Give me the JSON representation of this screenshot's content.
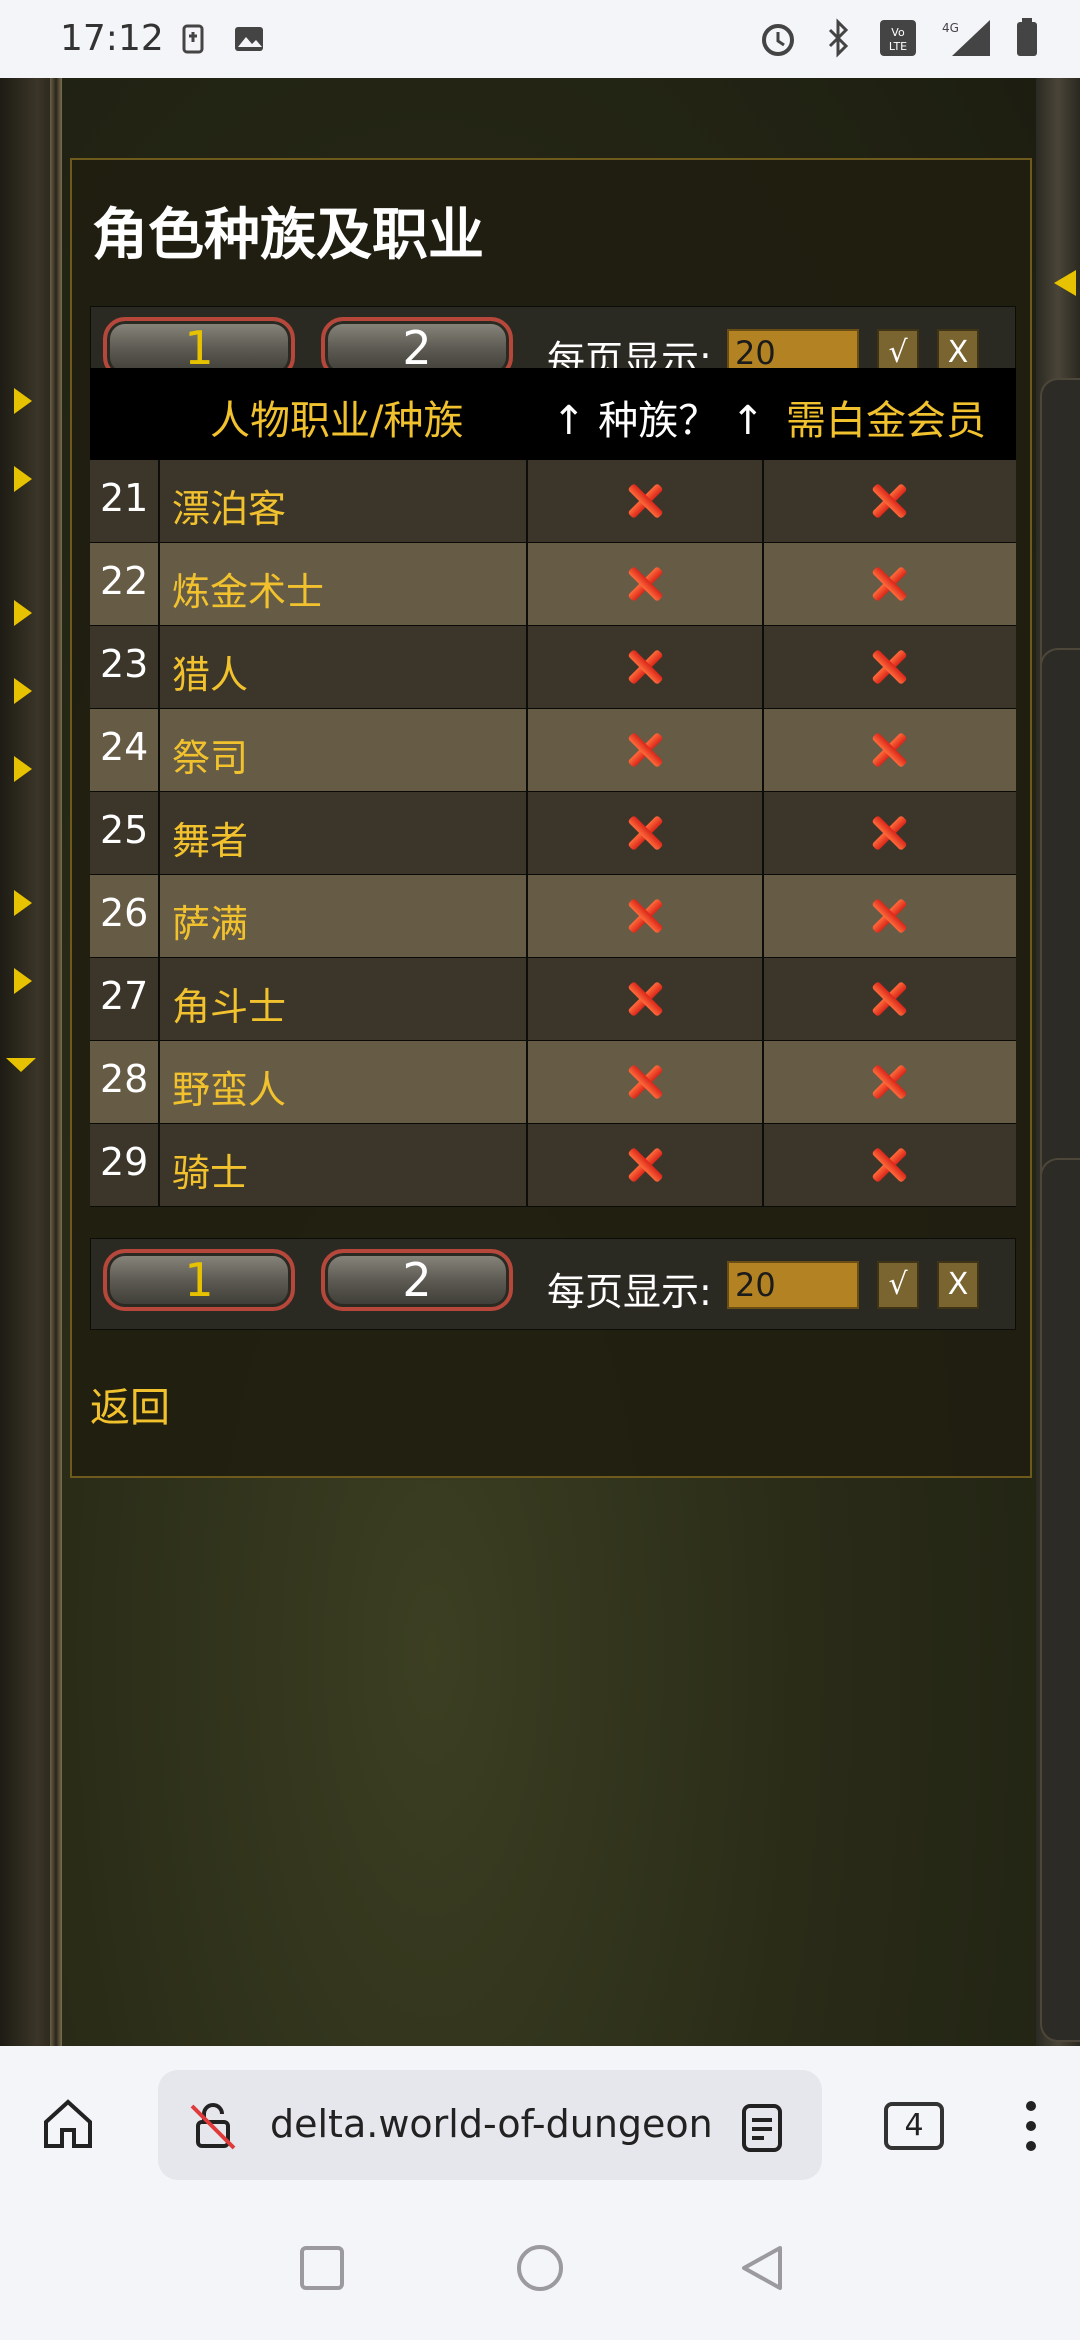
{
  "status_bar": {
    "time": "17:12",
    "icons": [
      "notification-icon",
      "image-icon",
      "alarm-icon",
      "bluetooth-icon",
      "volte-icon",
      "signal-4g-icon",
      "battery-icon"
    ]
  },
  "page": {
    "title": "角色种族及职业",
    "pager": {
      "pages": [
        "1",
        "2"
      ],
      "per_page_label": "每页显示:",
      "per_page_value": "20",
      "confirm_label": "√",
      "clear_label": "X"
    },
    "table": {
      "headers": {
        "name": "人物职业/种族",
        "race": "↑ 种族？ ↑",
        "gold": "需白金会员"
      },
      "rows": [
        {
          "num": "21",
          "name": "漂泊客"
        },
        {
          "num": "22",
          "name": "炼金术士"
        },
        {
          "num": "23",
          "name": "猎人"
        },
        {
          "num": "24",
          "name": "祭司"
        },
        {
          "num": "25",
          "name": "舞者"
        },
        {
          "num": "26",
          "name": "萨满"
        },
        {
          "num": "27",
          "name": "角斗士"
        },
        {
          "num": "28",
          "name": "野蛮人"
        },
        {
          "num": "29",
          "name": "骑士"
        }
      ]
    },
    "back_link": "返回"
  },
  "browser": {
    "url": "delta.world-of-dungeons",
    "tab_count": "4"
  },
  "colors": {
    "accent_gold": "#f1c22e",
    "row_dark": "#3b352a",
    "row_light": "#665b45",
    "cross_red": "#e2371f"
  }
}
